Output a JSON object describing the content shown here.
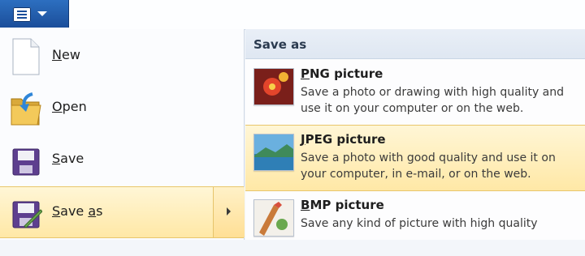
{
  "left_menu": {
    "items": [
      {
        "label": "New",
        "icon": "new-document-icon"
      },
      {
        "label": "Open",
        "icon": "open-folder-icon"
      },
      {
        "label": "Save",
        "icon": "floppy-disk-icon"
      },
      {
        "label_prefix": "Save ",
        "label_underlined": "a",
        "label_suffix": "s",
        "icon": "save-as-icon"
      }
    ]
  },
  "save_as_panel": {
    "title": "Save as",
    "formats": [
      {
        "title": "PNG picture",
        "description": "Save a photo or drawing with high quality and use it on your computer or on the web.",
        "icon": "png-picture-icon"
      },
      {
        "title": "JPEG picture",
        "description": "Save a photo with good quality and use it on your computer, in e-mail, or on the web.",
        "icon": "jpeg-picture-icon"
      },
      {
        "title": "BMP picture",
        "description": "Save any kind of picture with high quality",
        "icon": "bmp-picture-icon"
      }
    ]
  },
  "colors": {
    "app_button": "#1b4e9a",
    "highlight": "#ffe8a6",
    "highlight_border": "#e9c66b"
  }
}
